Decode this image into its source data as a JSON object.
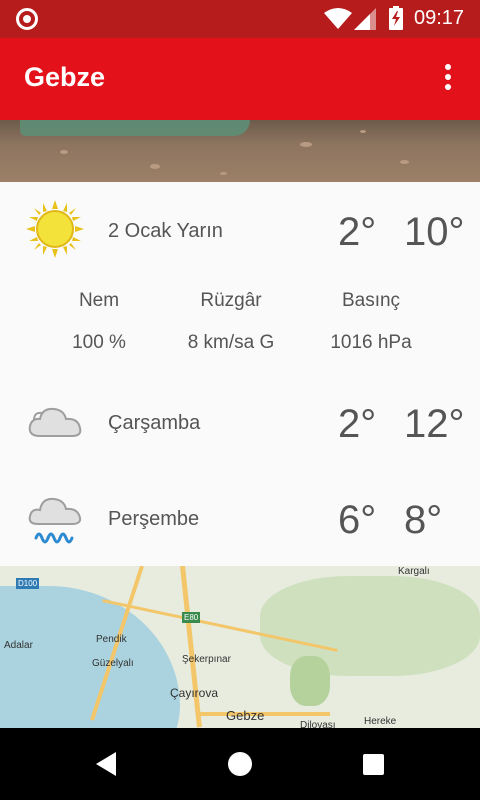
{
  "status_bar": {
    "time": "09:17",
    "icons": [
      "record-icon",
      "wifi-icon",
      "signal-icon",
      "battery-charging-icon"
    ]
  },
  "app_bar": {
    "title": "Gebze",
    "menu_icon": "overflow-menu-icon",
    "color": "#e3121a"
  },
  "today": {
    "icon": "sun-icon",
    "day": "2 Ocak Yarın",
    "low": "2°",
    "high": "10°",
    "details": {
      "humidity_label": "Nem",
      "humidity_value": "100 %",
      "wind_label": "Rüzgâr",
      "wind_value": "8 km/sa G",
      "pressure_label": "Basınç",
      "pressure_value": "1016 hPa"
    }
  },
  "forecast": [
    {
      "icon": "cloud-icon",
      "day": "Çarşamba",
      "low": "2°",
      "high": "12°"
    },
    {
      "icon": "rain-cloud-icon",
      "day": "Perşembe",
      "low": "6°",
      "high": "8°"
    }
  ],
  "map": {
    "labels": {
      "d100": "D100",
      "kargali": "Kargalı",
      "e80": "E80",
      "adalar": "Adalar",
      "pendik": "Pendik",
      "guzelyali": "Güzelyalı",
      "sekerpinar": "Şekerpınar",
      "cayirova": "Çayırova",
      "gebze": "Gebze",
      "dilovasi": "Dilovası",
      "hereke": "Hereke"
    }
  },
  "nav_bar": {
    "icons": [
      "back-icon",
      "home-icon",
      "recents-icon"
    ]
  }
}
